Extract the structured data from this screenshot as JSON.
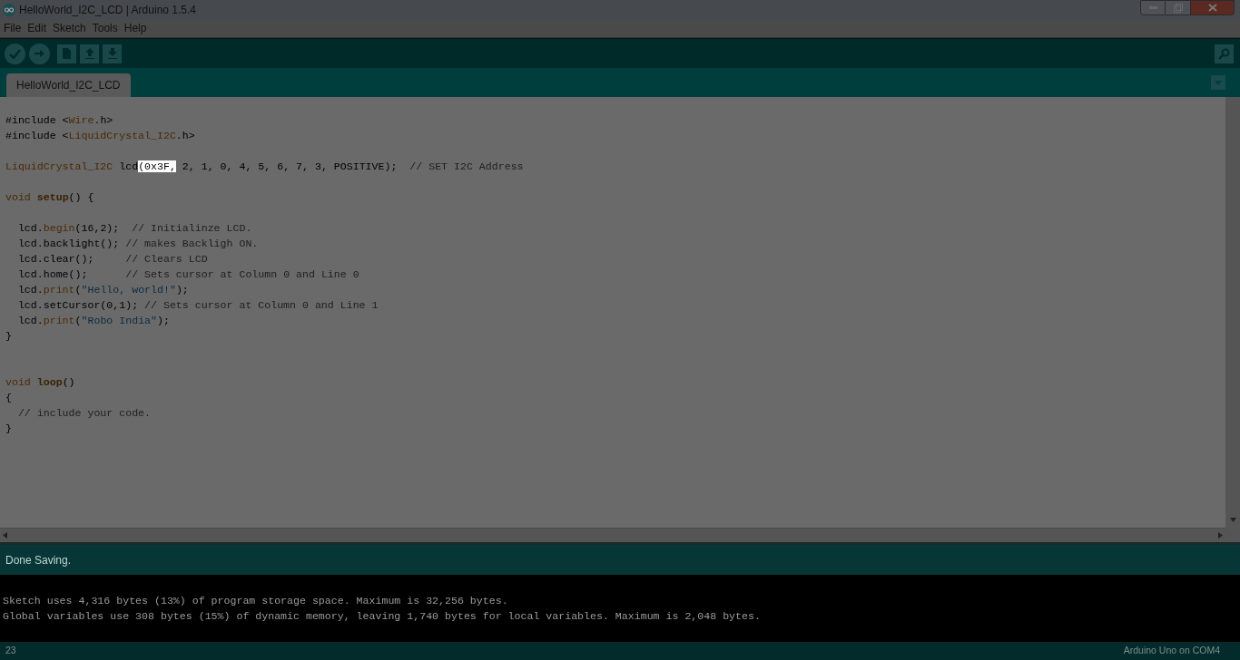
{
  "window": {
    "title": "HelloWorld_I2C_LCD | Arduino 1.5.4"
  },
  "menu": [
    "File",
    "Edit",
    "Sketch",
    "Tools",
    "Help"
  ],
  "tabs": [
    {
      "label": "HelloWorld_I2C_LCD",
      "selected": true
    }
  ],
  "code": [
    {
      "kind": "code",
      "tokens": [
        {
          "kind": "plain",
          "text": "#include <"
        },
        {
          "kind": "type",
          "text": "Wire"
        },
        {
          "kind": "plain",
          "text": ".h>"
        }
      ]
    },
    {
      "kind": "code",
      "tokens": [
        {
          "kind": "plain",
          "text": "#include <"
        },
        {
          "kind": "type",
          "text": "LiquidCrystal_I2C"
        },
        {
          "kind": "plain",
          "text": ".h>"
        }
      ]
    },
    {
      "kind": "blank"
    },
    {
      "kind": "code",
      "tokens": [
        {
          "kind": "type",
          "text": "LiquidCrystal_I2C"
        },
        {
          "kind": "plain",
          "text": " lcd"
        },
        {
          "kind": "selected",
          "text": "(0x3F,"
        },
        {
          "kind": "plain",
          "text": " 2, 1, 0, 4, 5, 6, 7, 3, POSITIVE);  "
        },
        {
          "kind": "comment",
          "text": "// SET I2C Address"
        }
      ]
    },
    {
      "kind": "blank"
    },
    {
      "kind": "code",
      "tokens": [
        {
          "kind": "type",
          "text": "void "
        },
        {
          "kind": "function",
          "text": "setup"
        },
        {
          "kind": "plain",
          "text": "() {"
        }
      ]
    },
    {
      "kind": "blank"
    },
    {
      "kind": "code",
      "tokens": [
        {
          "kind": "plain",
          "text": "  lcd."
        },
        {
          "kind": "type",
          "text": "begin"
        },
        {
          "kind": "plain",
          "text": "(16,2);  "
        },
        {
          "kind": "comment",
          "text": "// Initialinze LCD."
        }
      ]
    },
    {
      "kind": "code",
      "tokens": [
        {
          "kind": "plain",
          "text": "  lcd.backlight(); "
        },
        {
          "kind": "comment",
          "text": "// makes Backligh ON."
        }
      ]
    },
    {
      "kind": "code",
      "tokens": [
        {
          "kind": "plain",
          "text": "  lcd.clear();     "
        },
        {
          "kind": "comment",
          "text": "// Clears LCD"
        }
      ]
    },
    {
      "kind": "code",
      "tokens": [
        {
          "kind": "plain",
          "text": "  lcd.home();      "
        },
        {
          "kind": "comment",
          "text": "// Sets cursor at Column 0 and Line 0"
        }
      ]
    },
    {
      "kind": "code",
      "tokens": [
        {
          "kind": "plain",
          "text": "  lcd."
        },
        {
          "kind": "type",
          "text": "print"
        },
        {
          "kind": "plain",
          "text": "("
        },
        {
          "kind": "string",
          "text": "\"Hello, world!\""
        },
        {
          "kind": "plain",
          "text": ");"
        }
      ]
    },
    {
      "kind": "code",
      "tokens": [
        {
          "kind": "plain",
          "text": "  lcd.setCursor(0,1); "
        },
        {
          "kind": "comment",
          "text": "// Sets cursor at Column 0 and Line 1"
        }
      ]
    },
    {
      "kind": "code",
      "tokens": [
        {
          "kind": "plain",
          "text": "  lcd."
        },
        {
          "kind": "type",
          "text": "print"
        },
        {
          "kind": "plain",
          "text": "("
        },
        {
          "kind": "string",
          "text": "\"Robo India\""
        },
        {
          "kind": "plain",
          "text": ");"
        }
      ]
    },
    {
      "kind": "code",
      "tokens": [
        {
          "kind": "plain",
          "text": "}"
        }
      ]
    },
    {
      "kind": "blank"
    },
    {
      "kind": "blank"
    },
    {
      "kind": "code",
      "tokens": [
        {
          "kind": "type",
          "text": "void "
        },
        {
          "kind": "function",
          "text": "loop"
        },
        {
          "kind": "plain",
          "text": "()"
        }
      ]
    },
    {
      "kind": "code",
      "tokens": [
        {
          "kind": "plain",
          "text": "{"
        }
      ]
    },
    {
      "kind": "code",
      "tokens": [
        {
          "kind": "comment",
          "text": "  // include your code."
        }
      ]
    },
    {
      "kind": "code",
      "tokens": [
        {
          "kind": "plain",
          "text": "}"
        }
      ]
    }
  ],
  "status": "Done Saving.",
  "console": [
    "Sketch uses 4,316 bytes (13%) of program storage space. Maximum is 32,256 bytes.",
    "Global variables use 308 bytes (15%) of dynamic memory, leaving 1,740 bytes for local variables. Maximum is 2,048 bytes."
  ],
  "footer": {
    "line": "23",
    "board": "Arduino Uno on COM4"
  }
}
